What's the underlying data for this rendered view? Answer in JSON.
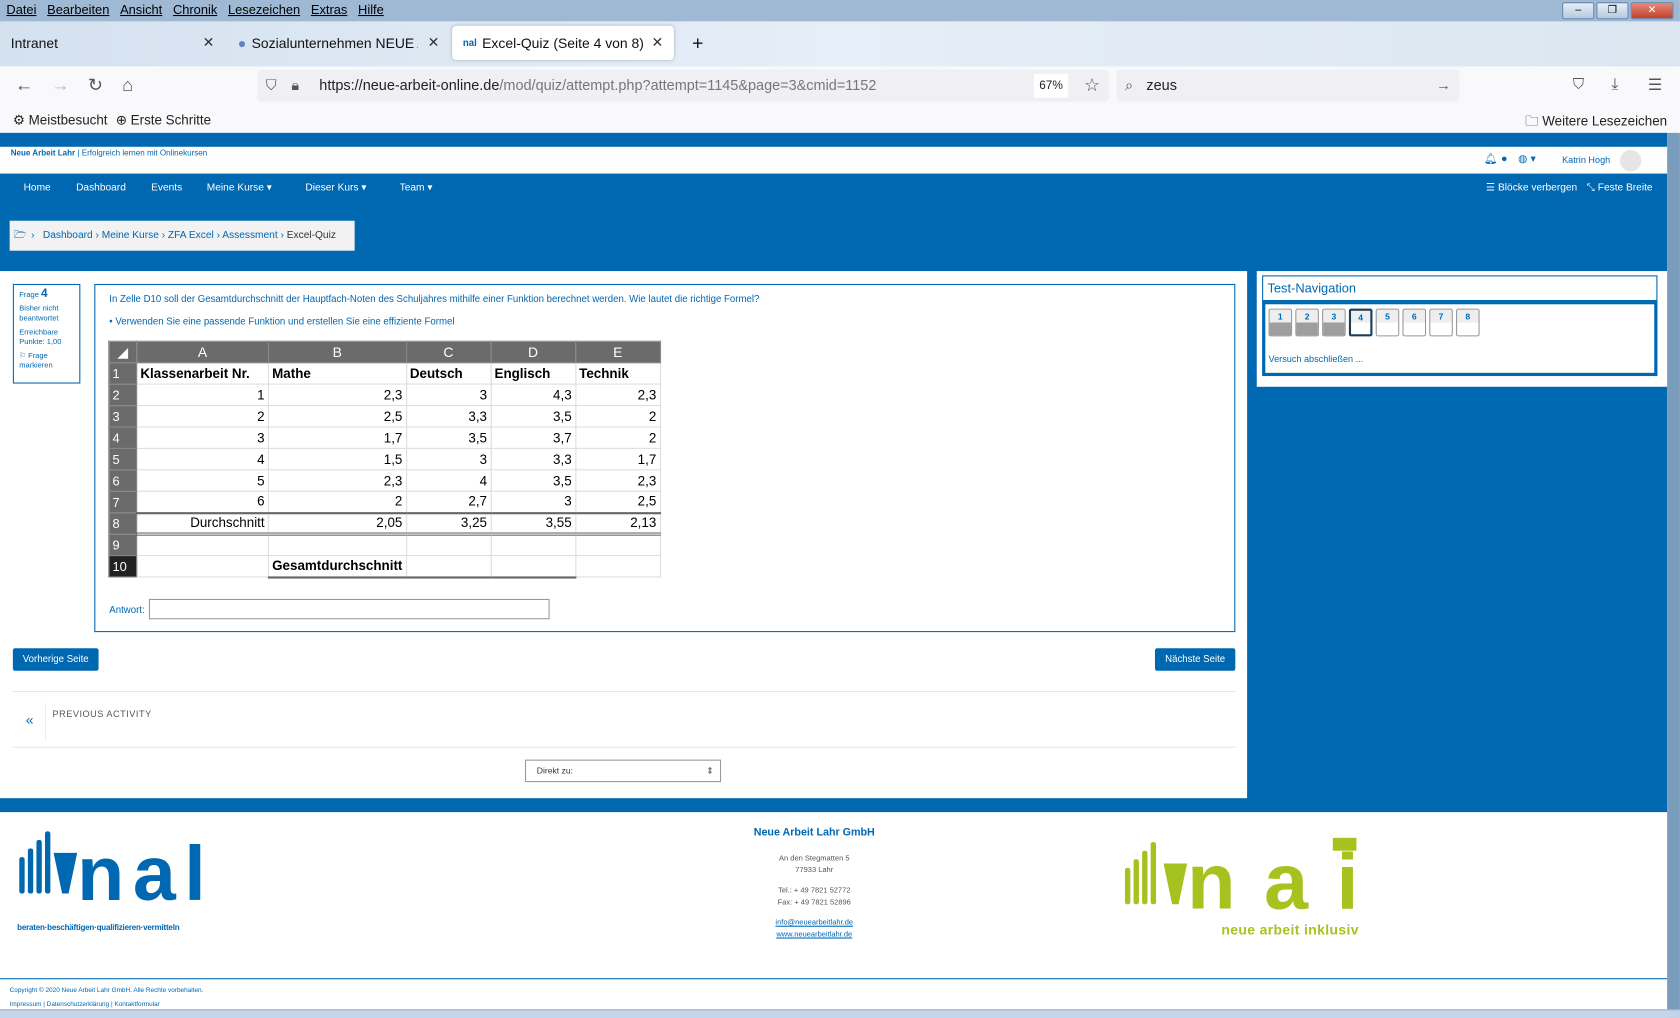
{
  "menubar": [
    "Datei",
    "Bearbeiten",
    "Ansicht",
    "Chronik",
    "Lesezeichen",
    "Extras",
    "Hilfe"
  ],
  "tabs": [
    {
      "label": "Intranet"
    },
    {
      "label": "Sozialunternehmen NEUE ARBEI"
    },
    {
      "label": "Excel-Quiz (Seite 4 von 8)",
      "active": true
    }
  ],
  "url": {
    "host": "https://neue-arbeit-online.de",
    "path": "/mod/quiz/attempt.php?attempt=1145&page=3&cmid=1152",
    "zoom": "67%"
  },
  "search": {
    "value": "zeus"
  },
  "bookmarks": [
    "Meistbesucht",
    "Erste Schritte"
  ],
  "other_bookmarks": "Weitere Lesezeichen",
  "site": {
    "brand": "Neue Arbeit Lahr",
    "tagline": "| Erfolgreich lernen mit Onlinekursen",
    "user": "Katrin Hogh",
    "accent": "#0067b1",
    "nav": [
      "Home",
      "Dashboard",
      "Events",
      "Meine Kurse ▾",
      "Dieser Kurs ▾",
      "Team ▾"
    ],
    "hide_blocks": "Blöcke verbergen",
    "fixed_width": "Feste Breite"
  },
  "breadcrumb": [
    "Dashboard",
    "Meine Kurse",
    "ZFA Excel",
    "Assessment",
    "Excel-Quiz"
  ],
  "question": {
    "label": "Frage",
    "number": "4",
    "status": "Bisher nicht beantwortet",
    "points": "Erreichbare Punkte: 1,00",
    "flag": "Frage markieren",
    "text": "In Zelle D10 soll der Gesamtdurchschnitt der Hauptfach-Noten des Schuljahres mithilfe einer Funktion berechnet werden. Wie lautet die richtige Formel?",
    "hint": "Verwenden Sie eine passende Funktion und erstellen Sie eine effiziente Formel",
    "answer_label": "Antwort:",
    "answer_value": ""
  },
  "sheet": {
    "cols": [
      "A",
      "B",
      "C",
      "D",
      "E"
    ],
    "rows": [
      [
        "1",
        "Klassenarbeit Nr.",
        "Mathe",
        "Deutsch",
        "Englisch",
        "Technik"
      ],
      [
        "2",
        "1",
        "2,3",
        "3",
        "4,3",
        "2,3"
      ],
      [
        "3",
        "2",
        "2,5",
        "3,3",
        "3,5",
        "2"
      ],
      [
        "4",
        "3",
        "1,7",
        "3,5",
        "3,7",
        "2"
      ],
      [
        "5",
        "4",
        "1,5",
        "3",
        "3,3",
        "1,7"
      ],
      [
        "6",
        "5",
        "2,3",
        "4",
        "3,5",
        "2,3"
      ],
      [
        "7",
        "6",
        "2",
        "2,7",
        "3",
        "2,5"
      ],
      [
        "8",
        "Durchschnitt",
        "2,05",
        "3,25",
        "3,55",
        "2,13"
      ],
      [
        "9",
        "",
        "",
        "",
        "",
        ""
      ],
      [
        "10",
        "",
        "Gesamtdurchschnitt",
        "",
        "",
        ""
      ]
    ]
  },
  "buttons": {
    "prev": "Vorherige Seite",
    "next": "Nächste Seite"
  },
  "prev_activity": "PREVIOUS ACTIVITY",
  "jump": "Direkt zu:",
  "testnav": {
    "title": "Test-Navigation",
    "pages": [
      "1",
      "2",
      "3",
      "4",
      "5",
      "6",
      "7",
      "8"
    ],
    "answered": [
      "1",
      "2",
      "3"
    ],
    "current": "4",
    "finish": "Versuch abschließen ..."
  },
  "footer": {
    "company": "Neue Arbeit Lahr GmbH",
    "street": "An den Stegmatten 5",
    "city": "77933 Lahr",
    "tel": "Tel.: + 49 7821 52772",
    "fax": "Fax: + 49 7821 52896",
    "email": "info@neuearbeitlahr.de",
    "web": "www.neuearbeitlahr.de",
    "logo1": "nal",
    "logo1_tag": "beraten·beschäftigen·qualifizieren·vermitteln",
    "logo2": "nai",
    "logo2_tag": "neue arbeit inklusiv",
    "copyright": "Copyright © 2020 Neue Arbeit Lahr GmbH. Alle Rechte vorbehalten.",
    "links": "Impressum | Datenschutzerklärung | Kontaktformular"
  }
}
